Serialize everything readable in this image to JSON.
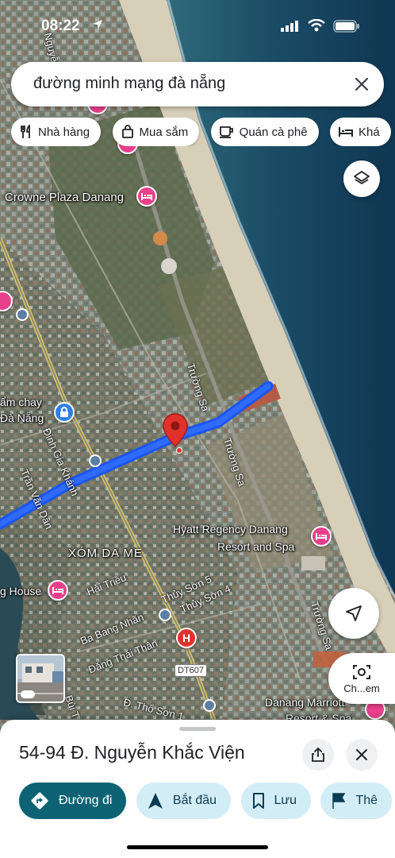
{
  "status_bar": {
    "time": "08:22"
  },
  "search": {
    "query": "đường minh mạng đà nẵng"
  },
  "chips": [
    {
      "icon": "restaurant-icon",
      "label": "Nhà hàng"
    },
    {
      "icon": "shopping-bag-icon",
      "label": "Mua sắm"
    },
    {
      "icon": "coffee-icon",
      "label": "Quán cà phê"
    },
    {
      "icon": "hotel-icon",
      "label": "Khá"
    }
  ],
  "map": {
    "labels": {
      "crowne": "Crowne Plaza Danang",
      "tam_chay": "ẩm chay",
      "da_nang": "Đà Nẵng",
      "dinh_gia_khanh": "Đinh Gia Khánh",
      "tran_van_dan": "Trần Văn Dần",
      "truong_sa_1": "Trường Sa",
      "truong_sa_2": "Trường Sa",
      "truong_sa_3": "Trường Sa",
      "hyatt": "Hyatt Regency Danang",
      "hyatt2": "Resort and Spa",
      "xom_da_me": "XÓM DA ME",
      "hai_trieu": "Hải Triều",
      "g_house": "g House",
      "thuy_son_5": "Thủy Sơn 5",
      "thuy_son_4": "Thủy Sơn 4",
      "ba_bang_nhan": "Ba Bang Nhãn",
      "dang_thai_than": "Đặng Thái Thân",
      "dt607": "DT607",
      "tho_son": "Đ. Thổ Sơn 1",
      "bui": "Bùi T",
      "marriott": "Danang Marriott",
      "marriott2": "Resort & Spa",
      "nguyen": "Nguyễ"
    }
  },
  "floating": {
    "chem_label": "Ch...em"
  },
  "place": {
    "title": "54-94 Đ. Nguyễn Khắc Viện"
  },
  "actions": [
    {
      "icon": "directions-icon",
      "label": "Đường đi"
    },
    {
      "icon": "navigation-icon",
      "label": "Bắt đầu"
    },
    {
      "icon": "bookmark-icon",
      "label": "Lưu"
    },
    {
      "icon": "flag-icon",
      "label": "Thê"
    }
  ],
  "colors": {
    "route": "#1a56f0",
    "pin": "#e0312c",
    "primary_action": "#0d6374",
    "secondary_action": "#d3edf6"
  }
}
